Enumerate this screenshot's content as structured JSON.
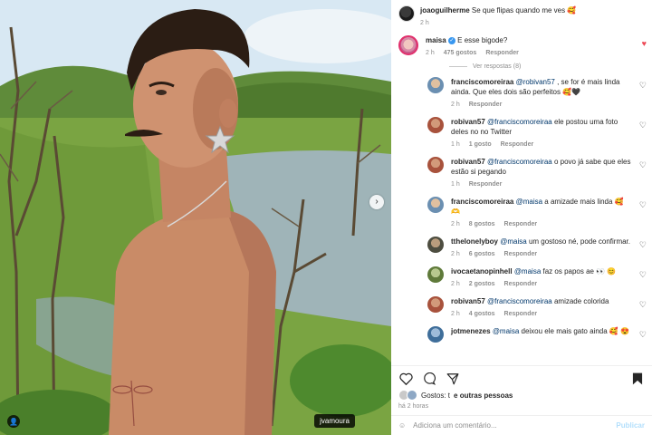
{
  "photo": {
    "tag_label": "jvamoura"
  },
  "caption": {
    "username": "joaoguilherme",
    "text": "Se que flipas quando me ves 🥰",
    "time": "2 h"
  },
  "top_comment": {
    "username": "maisa",
    "text": "E esse bigode?",
    "time": "2 h",
    "likes": "475 gostos",
    "reply": "Responder",
    "view_replies": "Ver respostas (8)"
  },
  "replies": [
    {
      "username": "franciscomoreiraa",
      "mention": "@robivan57",
      "text": " , se for é mais linda ainda. Que eles dois são perfeitos 🥰🖤",
      "time": "2 h",
      "likes": "",
      "reply": "Responder",
      "avatar": "fm"
    },
    {
      "username": "robivan57",
      "mention": "@franciscomoreiraa",
      "text": " ele postou uma foto deles no no Twitter",
      "time": "1 h",
      "likes": "1 gosto",
      "reply": "Responder",
      "avatar": "rb"
    },
    {
      "username": "robivan57",
      "mention": "@franciscomoreiraa",
      "text": " o povo já sabe que eles estão si pegando",
      "time": "1 h",
      "likes": "",
      "reply": "Responder",
      "avatar": "rb"
    },
    {
      "username": "franciscomoreiraa",
      "mention": "@maisa",
      "text": " a amizade mais linda 🥰 🫶",
      "time": "2 h",
      "likes": "8 gostos",
      "reply": "Responder",
      "avatar": "fm"
    },
    {
      "username": "tthelonelyboy",
      "mention": "@maisa",
      "text": " um gostoso né, pode confirmar.",
      "time": "2 h",
      "likes": "6 gostos",
      "reply": "Responder",
      "avatar": "tl"
    },
    {
      "username": "ivocaetanopinhell",
      "mention": "@maisa",
      "text": " faz os papos ae 👀 😊",
      "time": "2 h",
      "likes": "2 gostos",
      "reply": "Responder",
      "avatar": "ic"
    },
    {
      "username": "robivan57",
      "mention": "@franciscomoreiraa",
      "text": " amizade colorida",
      "time": "2 h",
      "likes": "4 gostos",
      "reply": "Responder",
      "avatar": "rb"
    },
    {
      "username": "jotmenezes",
      "mention": "@maisa",
      "text": " deixou ele mais gato ainda 🥰 😍",
      "time": "",
      "likes": "",
      "reply": "",
      "avatar": "jm"
    }
  ],
  "footer": {
    "likes_prefix": "Gostos: t",
    "likes_suffix": "e outras pessoas",
    "posted": "há 2 horas",
    "comment_placeholder": "Adiciona um comentário...",
    "publish": "Publicar"
  },
  "colors": {
    "accent_like": "#ed4956",
    "verified": "#3897f0",
    "mention": "#00376b"
  }
}
